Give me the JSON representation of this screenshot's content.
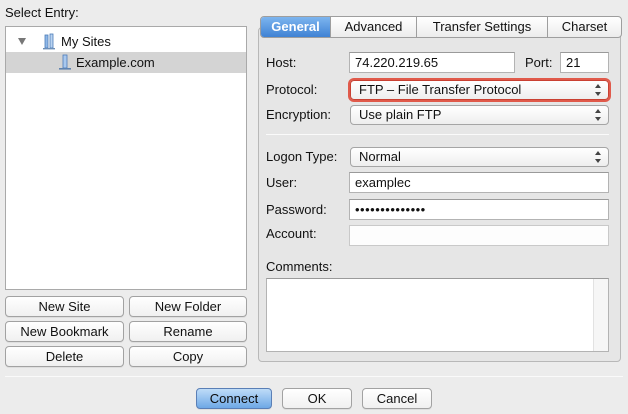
{
  "left": {
    "select_entry_label": "Select Entry:",
    "tree": [
      {
        "label": "My Sites",
        "icon": "folder-icon",
        "expanded": true
      },
      {
        "label": "Example.com",
        "icon": "site-icon",
        "selected": true
      }
    ],
    "buttons": {
      "new_site": "New Site",
      "new_folder": "New Folder",
      "new_bookmark": "New Bookmark",
      "rename": "Rename",
      "delete": "Delete",
      "copy": "Copy"
    }
  },
  "tabs": [
    {
      "label": "General",
      "active": true
    },
    {
      "label": "Advanced"
    },
    {
      "label": "Transfer Settings"
    },
    {
      "label": "Charset"
    }
  ],
  "general": {
    "host_label": "Host:",
    "host_value": "74.220.219.65",
    "port_label": "Port:",
    "port_value": "21",
    "protocol_label": "Protocol:",
    "protocol_value": "FTP – File Transfer Protocol",
    "encryption_label": "Encryption:",
    "encryption_value": "Use plain FTP",
    "logon_type_label": "Logon Type:",
    "logon_type_value": "Normal",
    "user_label": "User:",
    "user_value": "examplec",
    "password_label": "Password:",
    "password_value": "••••••••••••••",
    "account_label": "Account:",
    "account_value": "",
    "comments_label": "Comments:",
    "comments_value": ""
  },
  "footer": {
    "connect": "Connect",
    "ok": "OK",
    "cancel": "Cancel"
  },
  "colors": {
    "active_tab": "#3f82d4",
    "focus_ring": "#e05a4b",
    "selection": "#d4d4d4"
  }
}
